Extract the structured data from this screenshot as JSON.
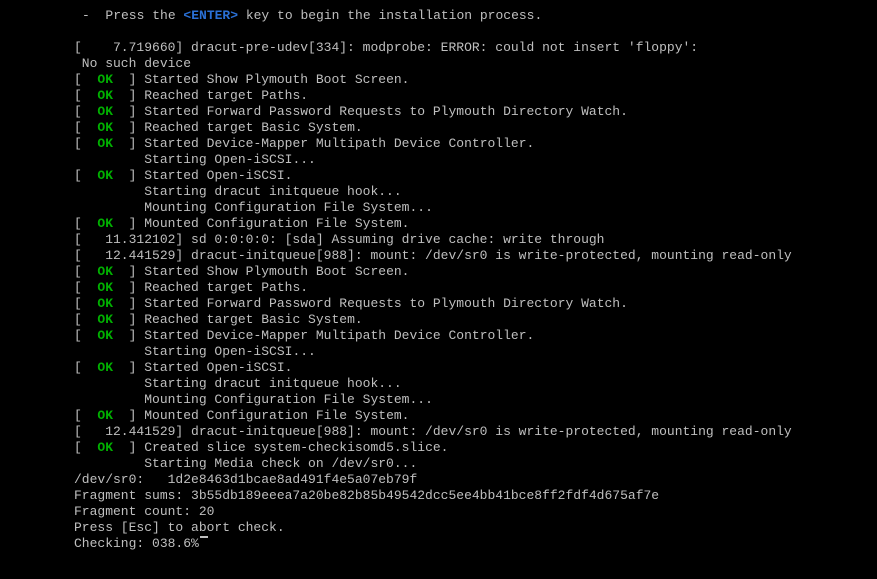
{
  "hint": {
    "prefix": "-  Press the ",
    "key": "<ENTER>",
    "suffix": " key to begin the installation process."
  },
  "lines": [
    {
      "status": null,
      "text": "[    7.719660] dracut-pre-udev[334]: modprobe: ERROR: could not insert 'floppy':"
    },
    {
      "status": null,
      "text": " No such device"
    },
    {
      "status": "OK",
      "text": "Started Show Plymouth Boot Screen."
    },
    {
      "status": "OK",
      "text": "Reached target Paths."
    },
    {
      "status": "OK",
      "text": "Started Forward Password Requests to Plymouth Directory Watch."
    },
    {
      "status": "OK",
      "text": "Reached target Basic System."
    },
    {
      "status": "OK",
      "text": "Started Device-Mapper Multipath Device Controller."
    },
    {
      "status": null,
      "indent": true,
      "text": "Starting Open-iSCSI..."
    },
    {
      "status": "OK",
      "text": "Started Open-iSCSI."
    },
    {
      "status": null,
      "indent": true,
      "text": "Starting dracut initqueue hook..."
    },
    {
      "status": null,
      "indent": true,
      "text": "Mounting Configuration File System..."
    },
    {
      "status": "OK",
      "text": "Mounted Configuration File System."
    },
    {
      "status": null,
      "text": "[   11.312102] sd 0:0:0:0: [sda] Assuming drive cache: write through"
    },
    {
      "status": null,
      "text": "[   12.441529] dracut-initqueue[988]: mount: /dev/sr0 is write-protected, mounting read-only"
    },
    {
      "status": "OK",
      "text": "Started Show Plymouth Boot Screen."
    },
    {
      "status": "OK",
      "text": "Reached target Paths."
    },
    {
      "status": "OK",
      "text": "Started Forward Password Requests to Plymouth Directory Watch."
    },
    {
      "status": "OK",
      "text": "Reached target Basic System."
    },
    {
      "status": "OK",
      "text": "Started Device-Mapper Multipath Device Controller."
    },
    {
      "status": null,
      "indent": true,
      "text": "Starting Open-iSCSI..."
    },
    {
      "status": "OK",
      "text": "Started Open-iSCSI."
    },
    {
      "status": null,
      "indent": true,
      "text": "Starting dracut initqueue hook..."
    },
    {
      "status": null,
      "indent": true,
      "text": "Mounting Configuration File System..."
    },
    {
      "status": "OK",
      "text": "Mounted Configuration File System."
    },
    {
      "status": null,
      "text": "[   12.441529] dracut-initqueue[988]: mount: /dev/sr0 is write-protected, mounting read-only"
    },
    {
      "status": "OK",
      "text": "Created slice system-checkisomd5.slice."
    },
    {
      "status": null,
      "indent": true,
      "text": "Starting Media check on /dev/sr0..."
    },
    {
      "status": null,
      "text": "/dev/sr0:   1d2e8463d1bcae8ad491f4e5a07eb79f"
    },
    {
      "status": null,
      "text": "Fragment sums: 3b55db189eeea7a20be82b85b49542dcc5ee4bb41bce8ff2fdf4d675af7e"
    },
    {
      "status": null,
      "text": "Fragment count: 20"
    },
    {
      "status": null,
      "text": "Press [Esc] to abort check."
    },
    {
      "status": null,
      "text": "Checking: 038.6%",
      "cursor": true
    }
  ],
  "status_open": "[  ",
  "status_close": "  ] ",
  "indent_pad": "         "
}
